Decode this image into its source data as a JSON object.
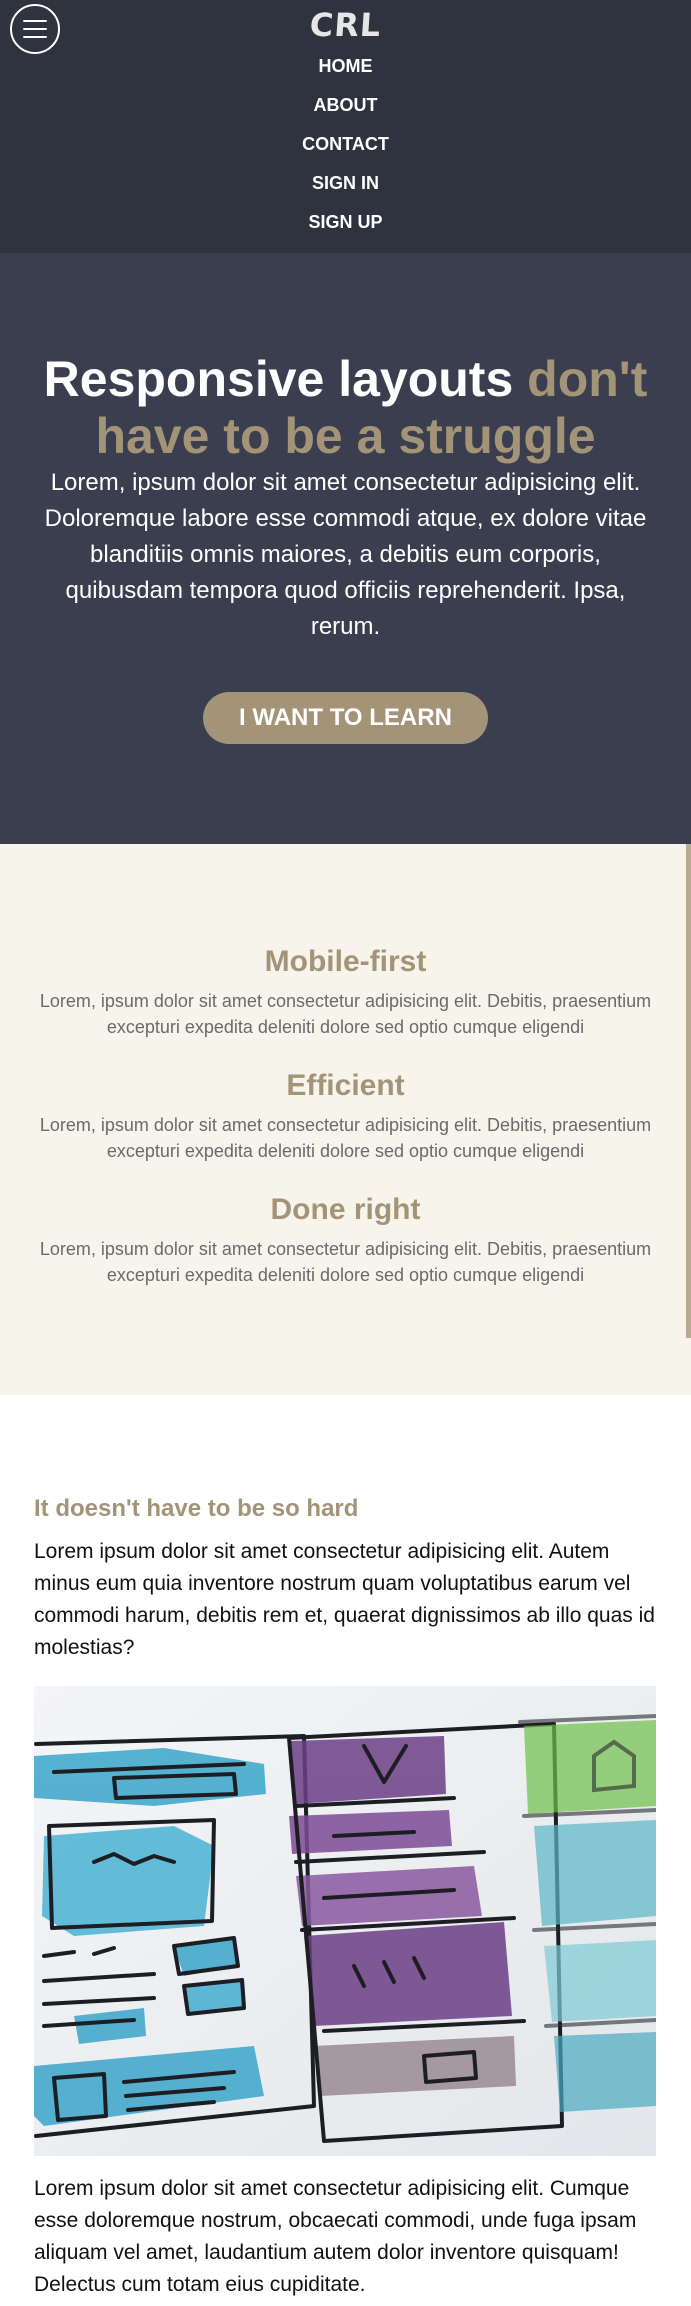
{
  "nav": {
    "logo": "CRL",
    "items": [
      {
        "label": "HOME"
      },
      {
        "label": "ABOUT"
      },
      {
        "label": "CONTACT"
      },
      {
        "label": "SIGN IN"
      },
      {
        "label": "SIGN UP"
      }
    ],
    "menu_icon": "hamburger-menu-icon"
  },
  "hero": {
    "title_main": "Responsive layouts",
    "title_accent": "don't have to be a struggle",
    "text": "Lorem, ipsum dolor sit amet consectetur adipisicing elit. Doloremque labore esse commodi atque, ex dolore vitae blanditiis omnis maiores, a debitis eum corporis, quibusdam tempora quod officiis reprehenderit. Ipsa, rerum.",
    "cta_label": "I WANT TO LEARN"
  },
  "features": [
    {
      "title": "Mobile-first",
      "text": "Lorem, ipsum dolor sit amet consectetur adipisicing elit. Debitis, praesentium excepturi expedita deleniti dolore sed optio cumque eligendi"
    },
    {
      "title": "Efficient",
      "text": "Lorem, ipsum dolor sit amet consectetur adipisicing elit. Debitis, praesentium excepturi expedita deleniti dolore sed optio cumque eligendi"
    },
    {
      "title": "Done right",
      "text": "Lorem, ipsum dolor sit amet consectetur adipisicing elit. Debitis, praesentium excepturi expedita deleniti dolore sed optio cumque eligendi"
    }
  ],
  "content": {
    "heading": "It doesn't have to be so hard",
    "para1": "Lorem ipsum dolor sit amet consectetur adipisicing elit. Autem minus eum quia inventore nostrum quam voluptatibus earum vel commodi harum, debitis rem et, quaerat dignissimos ab illo quas id molestias?",
    "para2": "Lorem ipsum dolor sit amet consectetur adipisicing elit. Cumque esse doloremque nostrum, obcaecati commodi, unde fuga ipsam aliquam vel amet, laudantium autem dolor inventore quisquam! Delectus cum totam eius cupiditate."
  },
  "colors": {
    "nav_bg": "#2f323f",
    "hero_bg": "#3b3e4f",
    "accent": "#a39478",
    "features_bg": "#f7f4ec"
  }
}
